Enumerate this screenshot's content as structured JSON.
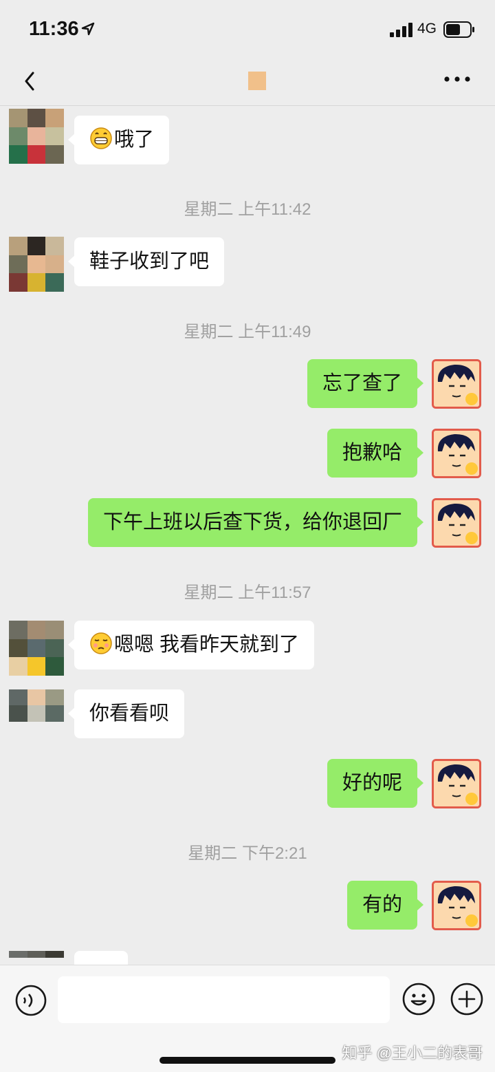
{
  "status_bar": {
    "time": "11:36",
    "network": "4G"
  },
  "nav": {
    "back_icon": "chevron-left-icon",
    "more_icon": "more-dots-icon"
  },
  "messages": [
    {
      "side": "in",
      "emoji": "grin-emoji",
      "text": "哦了"
    },
    {
      "type": "time",
      "text": "星期二 上午11:42"
    },
    {
      "side": "in",
      "text": "鞋子收到了吧"
    },
    {
      "type": "time",
      "text": "星期二 上午11:49"
    },
    {
      "side": "out",
      "text": "忘了查了"
    },
    {
      "side": "out",
      "text": "抱歉哈"
    },
    {
      "side": "out",
      "text": "下午上班以后查下货，给你退回厂"
    },
    {
      "type": "time",
      "text": "星期二 上午11:57"
    },
    {
      "side": "in",
      "emoji": "smirk-emoji",
      "text": "嗯嗯 我看昨天就到了"
    },
    {
      "side": "in",
      "text": "你看看呗"
    },
    {
      "side": "out",
      "text": "好的呢"
    },
    {
      "type": "time",
      "text": "星期二 下午2:21"
    },
    {
      "side": "out",
      "text": "有的"
    }
  ],
  "input_bar": {
    "placeholder": ""
  },
  "watermark": "知乎 @王小二的表哥",
  "colors": {
    "incoming_bubble": "#ffffff",
    "outgoing_bubble": "#95ec69",
    "background": "#ededed"
  }
}
